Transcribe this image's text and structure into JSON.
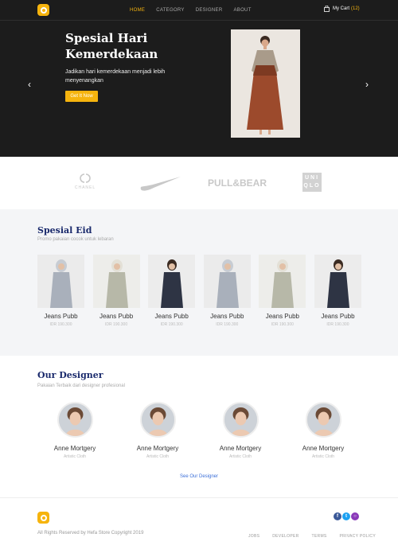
{
  "nav": {
    "links": [
      "HOME",
      "CATEGORY",
      "DESIGNER",
      "ABOUT"
    ],
    "cart_label": "My Cart",
    "cart_count": "(12)"
  },
  "hero": {
    "title": "Spesial Hari Kemerdekaan",
    "subtitle": "Jadikan hari kemerdekaan menjadi lebih menyenangkan",
    "cta": "Get It Now"
  },
  "brands": {
    "chanel": "CHANEL",
    "pull": "PULL&BEAR",
    "uniqlo_top": "UNI",
    "uniqlo_bottom": "QLO"
  },
  "eid": {
    "title": "Spesial Eid",
    "subtitle": "Promo pakaian cocok untuk lebaran",
    "products": [
      {
        "name": "Jeans Pubb",
        "price": "IDR 190.300"
      },
      {
        "name": "Jeans Pubb",
        "price": "IDR 190.300"
      },
      {
        "name": "Jeans Pubb",
        "price": "IDR 190.300"
      },
      {
        "name": "Jeans Pubb",
        "price": "IDR 190.300"
      },
      {
        "name": "Jeans Pubb",
        "price": "IDR 190.300"
      },
      {
        "name": "Jeans Pubb",
        "price": "IDR 190.300"
      }
    ]
  },
  "designers": {
    "title": "Our Designer",
    "subtitle": "Pakaian Terbaik dari designer profesional",
    "items": [
      {
        "name": "Anne Mortgery",
        "role": "Artistic Cloth"
      },
      {
        "name": "Anne Mortgery",
        "role": "Artistic Cloth"
      },
      {
        "name": "Anne Mortgery",
        "role": "Artistic Cloth"
      },
      {
        "name": "Anne Mortgery",
        "role": "Artistic Cloth"
      }
    ],
    "see_all": "See Our Designer"
  },
  "footer": {
    "copyright": "All Rights Reserved by Hefa Store Copyright 2019",
    "links": [
      "JOBS",
      "DEVELOPER",
      "TERMS",
      "PRIVACY POLICY"
    ]
  },
  "icons": {
    "logo": "logo-icon",
    "cart": "shopping-bag-icon",
    "prev": "chevron-left-icon",
    "next": "chevron-right-icon",
    "facebook": "facebook-icon",
    "twitter": "twitter-icon",
    "instagram": "instagram-icon"
  },
  "colors": {
    "accent": "#f6b40e",
    "hero_bg": "#1c1c1c",
    "title_navy": "#1a2a6c",
    "link_blue": "#3b6fd8"
  }
}
